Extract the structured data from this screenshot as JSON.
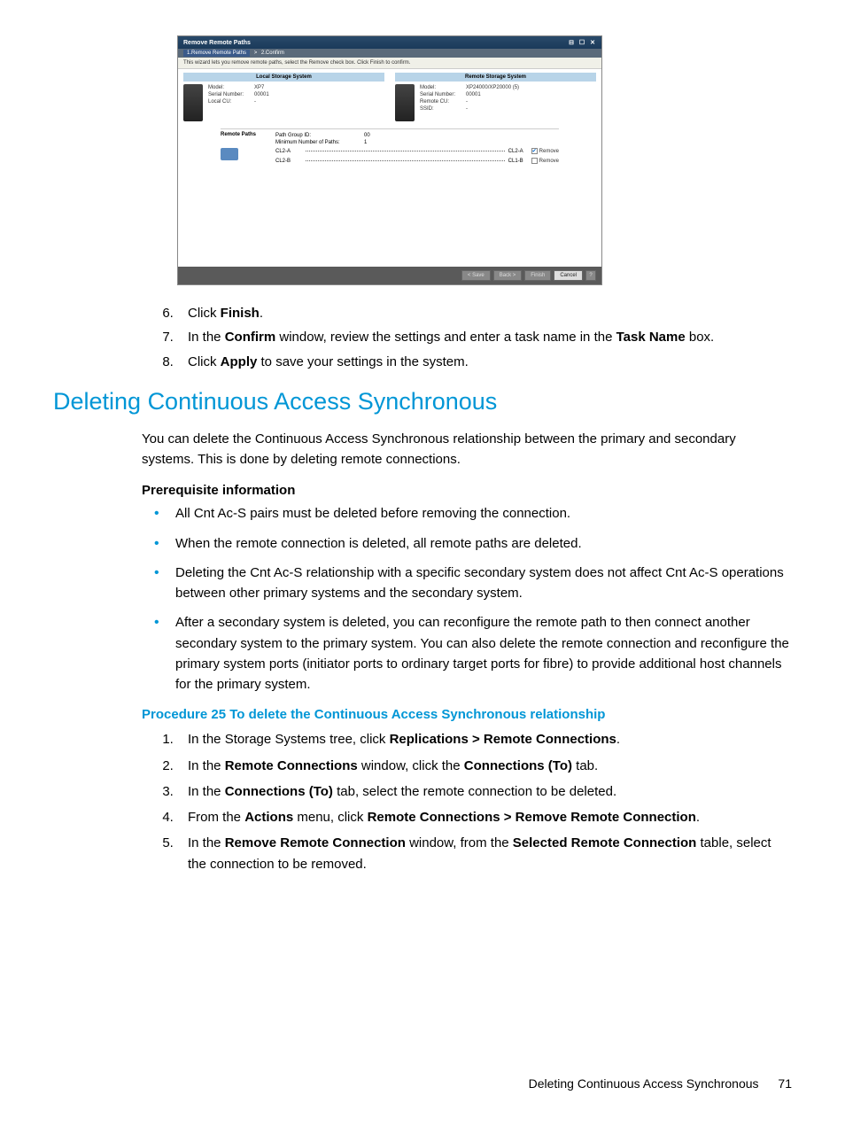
{
  "dialog": {
    "title": "Remove Remote Paths",
    "crumb_active": "1.Remove Remote Paths",
    "crumb_sep": ">",
    "crumb_next": "2.Confirm",
    "hint": "This wizard lets you remove remote paths, select the Remove check box. Click Finish to confirm.",
    "local": {
      "header": "Local Storage System",
      "model_lbl": "Model:",
      "model_val": "XP7",
      "serial_lbl": "Serial Number:",
      "serial_val": "00001",
      "cu_lbl": "Local CU:",
      "cu_val": "-"
    },
    "remote": {
      "header": "Remote Storage System",
      "model_lbl": "Model:",
      "model_val": "XP24000/XP20000 (5)",
      "serial_lbl": "Serial Number:",
      "serial_val": "00001",
      "cu_lbl": "Remote CU:",
      "cu_val": "-",
      "ssid_lbl": "SSID:",
      "ssid_val": "-"
    },
    "rp": {
      "title": "Remote Paths",
      "pg_lbl": "Path Group ID:",
      "pg_val": "00",
      "min_lbl": "Minimum Number of Paths:",
      "min_val": "1",
      "rows": [
        {
          "a": "CL2-A",
          "b": "CL2-A",
          "remove": "Remove",
          "checked": true
        },
        {
          "a": "CL2-B",
          "b": "CL1-B",
          "remove": "Remove",
          "checked": false
        }
      ]
    },
    "footer": {
      "save": "< Save",
      "back": "Back >",
      "finish": "Finish",
      "cancel": "Cancel"
    }
  },
  "steps_upper": [
    {
      "n": "6",
      "pre": "Click ",
      "b1": "Finish",
      "post": "."
    },
    {
      "n": "7",
      "pre": "In the ",
      "b1": "Confirm",
      "mid": " window, review the settings and enter a task name in the ",
      "b2": "Task Name",
      "post": " box."
    },
    {
      "n": "8",
      "pre": "Click ",
      "b1": "Apply",
      "post": " to save your settings in the system."
    }
  ],
  "section_title": "Deleting Continuous Access Synchronous",
  "intro": "You can delete the Continuous Access Synchronous relationship between the primary and secondary systems. This is done by deleting remote connections.",
  "prereq_head": "Prerequisite information",
  "bullets": [
    "All Cnt Ac-S pairs must be deleted before removing the connection.",
    "When the remote connection is deleted, all remote paths are deleted.",
    "Deleting the Cnt Ac-S relationship with a specific secondary system does not affect Cnt Ac-S operations between other primary systems and the secondary system.",
    "After a secondary system is deleted, you can reconfigure the remote path to then connect another secondary system to the primary system. You can also delete the remote connection and reconfigure the primary system ports (initiator ports to ordinary target ports for fibre) to provide additional host channels for the primary system."
  ],
  "proc_title": "Procedure 25 To delete the Continuous Access Synchronous relationship",
  "proc": [
    {
      "pre": "In the Storage Systems tree, click ",
      "b1": "Replications > Remote Connections",
      "post": "."
    },
    {
      "pre": "In the ",
      "b1": "Remote Connections",
      "mid": " window, click the ",
      "b2": "Connections (To)",
      "post": " tab."
    },
    {
      "pre": "In the ",
      "b1": "Connections (To)",
      "post": " tab, select the remote connection to be deleted."
    },
    {
      "pre": "From the ",
      "b1": "Actions",
      "mid": " menu, click ",
      "b2": "Remote Connections > Remove Remote Connection",
      "post": "."
    },
    {
      "pre": "In the ",
      "b1": "Remove Remote Connection",
      "mid": " window, from the ",
      "b2": "Selected Remote Connection",
      "post": " table, select the connection to be removed."
    }
  ],
  "footer_text": "Deleting Continuous Access Synchronous",
  "page_number": "71"
}
